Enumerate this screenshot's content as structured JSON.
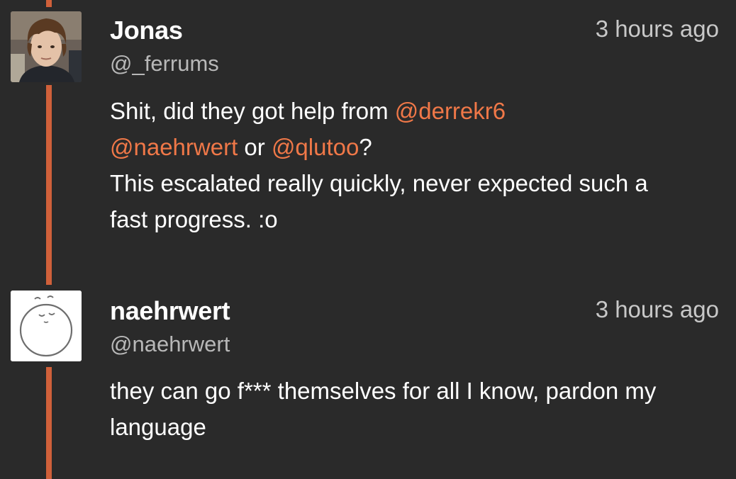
{
  "posts": [
    {
      "name": "Jonas",
      "handle": "@_ferrums",
      "time": "3 hours ago",
      "line1_text": "Shit, did they got help from ",
      "mention1": "@derrekr6",
      "mention2": "@naehrwert",
      "line2_mid": " or ",
      "mention3": "@qlutoo",
      "line2_end": "?",
      "line3": "This escalated really quickly, never expected such a",
      "line4": "fast progress. :o"
    },
    {
      "name": "naehrwert",
      "handle": "@naehrwert",
      "time": "3 hours ago",
      "line1": "they can go f*** themselves for all I know, pardon my",
      "line2": "language"
    }
  ],
  "colors": {
    "background": "#2a2a2a",
    "thread_line": "#d0603a",
    "mention": "#f07848",
    "handle": "#b8b8b8",
    "time": "#c8c8c8",
    "text": "#ffffff"
  },
  "icons": {
    "avatar1": "user-photo-avatar",
    "avatar2": "sleepy-face-drawing-avatar"
  }
}
